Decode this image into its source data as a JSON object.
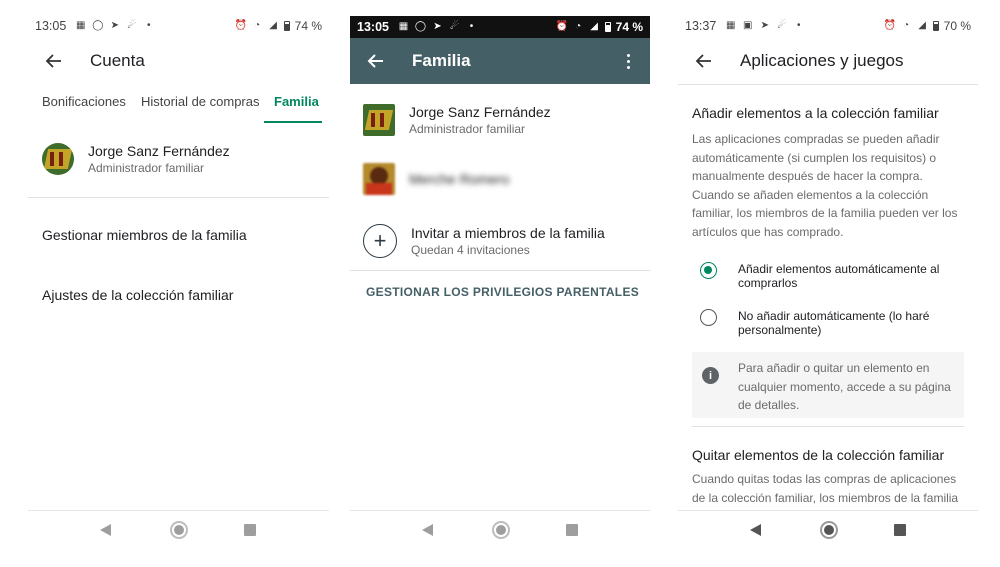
{
  "screen1": {
    "status": {
      "time": "13:05",
      "battery": "74 %"
    },
    "appbar": {
      "title": "Cuenta"
    },
    "tabs": [
      {
        "label": "Bonificaciones"
      },
      {
        "label": "Historial de compras"
      },
      {
        "label": "Familia",
        "active": true
      }
    ],
    "member": {
      "name": "Jorge Sanz Fernández",
      "role": "Administrador familiar"
    },
    "menu": [
      {
        "label": "Gestionar miembros de la familia"
      },
      {
        "label": "Ajustes de la colección familiar"
      }
    ]
  },
  "screen2": {
    "status": {
      "time": "13:05",
      "battery": "74 %"
    },
    "appbar": {
      "title": "Familia",
      "color": "#455f67"
    },
    "members": [
      {
        "name": "Jorge Sanz Fernández",
        "role": "Administrador familiar"
      },
      {
        "name": "Merche Romero",
        "role": ""
      }
    ],
    "invite": {
      "label": "Invitar a miembros de la familia",
      "sub": "Quedan 4 invitaciones"
    },
    "parental_link": "GESTIONAR LOS PRIVILEGIOS PARENTALES"
  },
  "screen3": {
    "status": {
      "time": "13:37",
      "battery": "70 %"
    },
    "appbar": {
      "title": "Aplicaciones y juegos"
    },
    "section1": {
      "title": "Añadir elementos a la colección familiar",
      "body": "Las aplicaciones compradas se pueden añadir automáticamente (si cumplen los requisitos) o manualmente después de hacer la compra. Cuando se añaden elementos a la colección familiar, los miembros de la familia pueden ver los artículos que has comprado."
    },
    "options": [
      {
        "label": "Añadir elementos automáticamente al comprarlos",
        "selected": true
      },
      {
        "label": "No añadir automáticamente (lo haré personalmente)",
        "selected": false
      }
    ],
    "info": "Para añadir o quitar un elemento en cualquier momento, accede a su página de detalles.",
    "section2": {
      "title": "Quitar elementos de la colección familiar",
      "body": "Cuando quitas todas las compras de aplicaciones de la colección familiar, los miembros de la familia"
    }
  },
  "colors": {
    "accent": "#01875f",
    "appbar_teal": "#455f67"
  }
}
